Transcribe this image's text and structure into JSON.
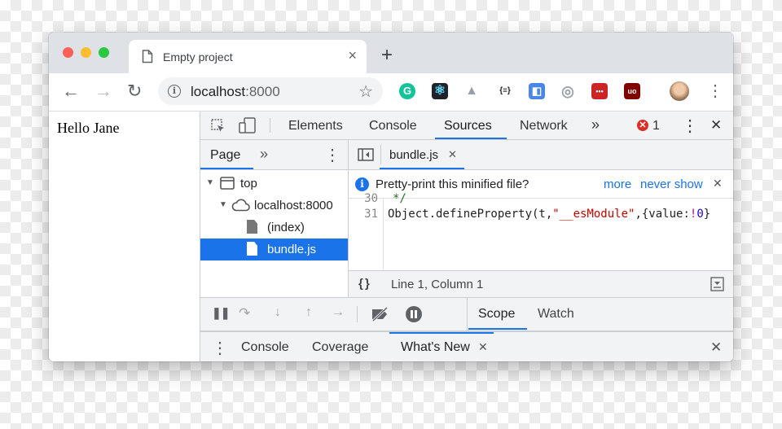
{
  "browser": {
    "tab_title": "Empty project",
    "tab_close": "×",
    "new_tab": "+",
    "url_host": "localhost",
    "url_port": ":8000",
    "extensions": [
      {
        "name": "grammarly-extension",
        "icon": "G",
        "color": "#15c39a"
      },
      {
        "name": "react-devtools-extension",
        "icon": "⚛",
        "color": "#222222"
      },
      {
        "name": "google-drive-extension",
        "icon": "▲",
        "color": "#9aa0a6"
      },
      {
        "name": "json-formatter-extension",
        "icon": "{≡}",
        "color": "#ffffff"
      },
      {
        "name": "code-extension",
        "icon": "◧",
        "color": "#4a86e8"
      },
      {
        "name": "target-extension",
        "icon": "◎",
        "color": "#ffffff"
      },
      {
        "name": "dots-extension",
        "icon": "•••",
        "color": "#cc2424"
      },
      {
        "name": "ublock-extension",
        "icon": "uo",
        "color": "#800000"
      }
    ]
  },
  "page": {
    "greeting": "Hello Jane"
  },
  "devtools": {
    "tabs": [
      "Elements",
      "Console",
      "Sources",
      "Network"
    ],
    "active_tab": "Sources",
    "more_tabs": "»",
    "error_count": "1",
    "close": "✕",
    "navigator": {
      "tab": "Page",
      "more": "»",
      "tree": [
        "top",
        "localhost:8000",
        "(index)",
        "bundle.js"
      ],
      "selected": "bundle.js"
    },
    "editor": {
      "file_tab": "bundle.js",
      "file_close": "✕",
      "banner_text": "Pretty-print this minified file?",
      "banner_more": "more",
      "banner_never": "never show",
      "banner_close": "✕",
      "line_numbers": [
        "30",
        "31"
      ],
      "code_comment": "*/",
      "code_prefix": "Object.defineProperty(t,",
      "code_string": "\"__esModule\"",
      "code_mid": ",{value:",
      "code_bang": "!",
      "code_num": "0",
      "code_end": "}",
      "status": "Line 1, Column 1",
      "format_btn": "{ }"
    },
    "scope_tabs": [
      "Scope",
      "Watch"
    ],
    "drawer": {
      "tabs": [
        "Console",
        "Coverage",
        "What's New"
      ],
      "active": "What's New",
      "tab_close": "✕",
      "close": "✕"
    }
  },
  "colors": {
    "accent": "#1a73e8",
    "error": "#d93025",
    "string": "#c80000",
    "keyword_num": "#1c00cf",
    "comment": "#236e25"
  }
}
